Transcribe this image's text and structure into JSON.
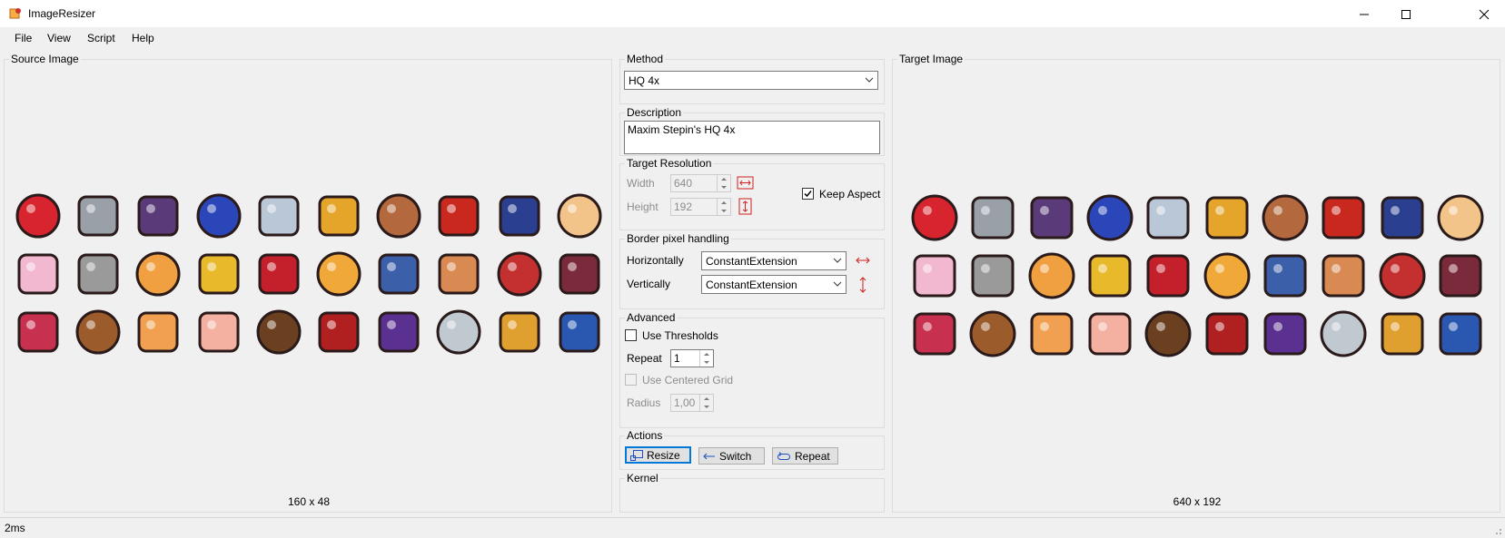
{
  "window": {
    "title": "ImageResizer"
  },
  "menu": [
    "File",
    "View",
    "Script",
    "Help"
  ],
  "source": {
    "title": "Source Image",
    "dimensions": "160 x 48"
  },
  "target": {
    "title": "Target Image",
    "dimensions": "640 x 192"
  },
  "method": {
    "title": "Method",
    "selected": "HQ 4x"
  },
  "description": {
    "title": "Description",
    "text": "Maxim Stepin's HQ 4x"
  },
  "resolution": {
    "title": "Target Resolution",
    "width_label": "Width",
    "width_value": "640",
    "height_label": "Height",
    "height_value": "192",
    "keep_aspect_label": "Keep Aspect"
  },
  "border": {
    "title": "Border pixel handling",
    "horizontal_label": "Horizontally",
    "horizontal_value": "ConstantExtension",
    "vertical_label": "Vertically",
    "vertical_value": "ConstantExtension"
  },
  "advanced": {
    "title": "Advanced",
    "use_thresholds_label": "Use Thresholds",
    "repeat_label": "Repeat",
    "repeat_value": "1",
    "centered_grid_label": "Use Centered Grid",
    "radius_label": "Radius",
    "radius_value": "1,00"
  },
  "actions": {
    "title": "Actions",
    "resize_label": "Resize",
    "switch_label": "Switch",
    "repeat_label": "Repeat"
  },
  "kernel": {
    "title": "Kernel"
  },
  "status": {
    "text": "2ms"
  },
  "sprites": [
    {
      "name": "strawberry-icon",
      "color": "#d8242f"
    },
    {
      "name": "armor-icon",
      "color": "#9aa0a8"
    },
    {
      "name": "pickaxe-icon",
      "color": "#5a3a78"
    },
    {
      "name": "berries-icon",
      "color": "#2b46b8"
    },
    {
      "name": "gem-icon",
      "color": "#b9c7d6"
    },
    {
      "name": "arrow-icon",
      "color": "#e5a52a"
    },
    {
      "name": "shield-icon",
      "color": "#b3683d"
    },
    {
      "name": "cape-icon",
      "color": "#c8281e"
    },
    {
      "name": "robe-icon",
      "color": "#2a3f8f"
    },
    {
      "name": "egg-icon",
      "color": "#f2c48a"
    },
    {
      "name": "cup-icon",
      "color": "#f2b8d0"
    },
    {
      "name": "scissors-icon",
      "color": "#9a9a9a"
    },
    {
      "name": "sparkle-icon",
      "color": "#f0a040"
    },
    {
      "name": "gold-armor-icon",
      "color": "#e9b92c"
    },
    {
      "name": "feathers-icon",
      "color": "#c4202c"
    },
    {
      "name": "mug-icon",
      "color": "#f0a838"
    },
    {
      "name": "axe-icon",
      "color": "#3b5fa8"
    },
    {
      "name": "sandwich-icon",
      "color": "#d98a52"
    },
    {
      "name": "dagger-icon",
      "color": "#c43030"
    },
    {
      "name": "sword-icon",
      "color": "#7a2a3a"
    },
    {
      "name": "tentacle-icon",
      "color": "#c83050"
    },
    {
      "name": "log-icon",
      "color": "#9b5b2a"
    },
    {
      "name": "donut-icon",
      "color": "#f0a050"
    },
    {
      "name": "peach-icon",
      "color": "#f4b0a0"
    },
    {
      "name": "boot-icon",
      "color": "#6a4020"
    },
    {
      "name": "potion-icon",
      "color": "#b02020"
    },
    {
      "name": "grapes-icon",
      "color": "#5a3090"
    },
    {
      "name": "skull-icon",
      "color": "#c0c8d0"
    },
    {
      "name": "cane-icon",
      "color": "#e0a030"
    },
    {
      "name": "mushroom-icon",
      "color": "#2a58b0"
    }
  ]
}
